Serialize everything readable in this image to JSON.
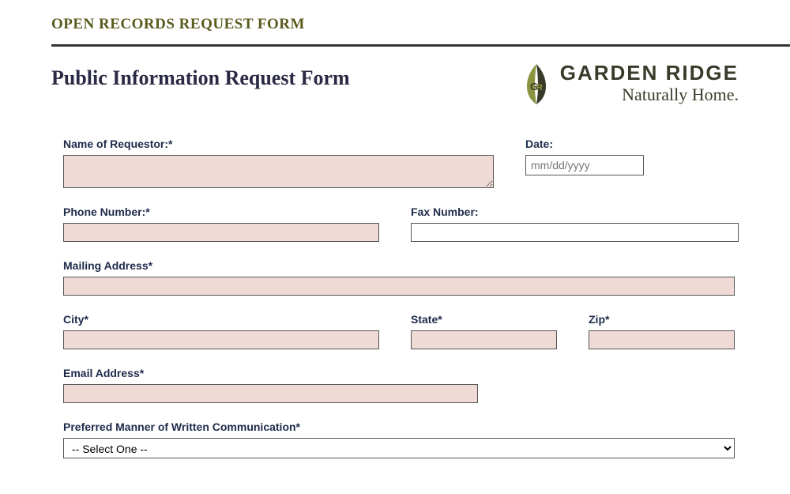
{
  "page_title": "OPEN RECORDS REQUEST FORM",
  "form_title": "Public Information Request Form",
  "logo": {
    "name": "GARDEN RIDGE",
    "tagline": "Naturally Home."
  },
  "fields": {
    "name_label": "Name of Requestor:*",
    "date_label": "Date:",
    "date_placeholder": "mm/dd/yyyy",
    "phone_label": "Phone Number:*",
    "fax_label": "Fax Number:",
    "mailing_label": "Mailing Address*",
    "city_label": "City*",
    "state_label": "State*",
    "zip_label": "Zip*",
    "email_label": "Email Address*",
    "preferred_label": "Preferred Manner of Written Communication*",
    "select_placeholder": "-- Select One --"
  }
}
